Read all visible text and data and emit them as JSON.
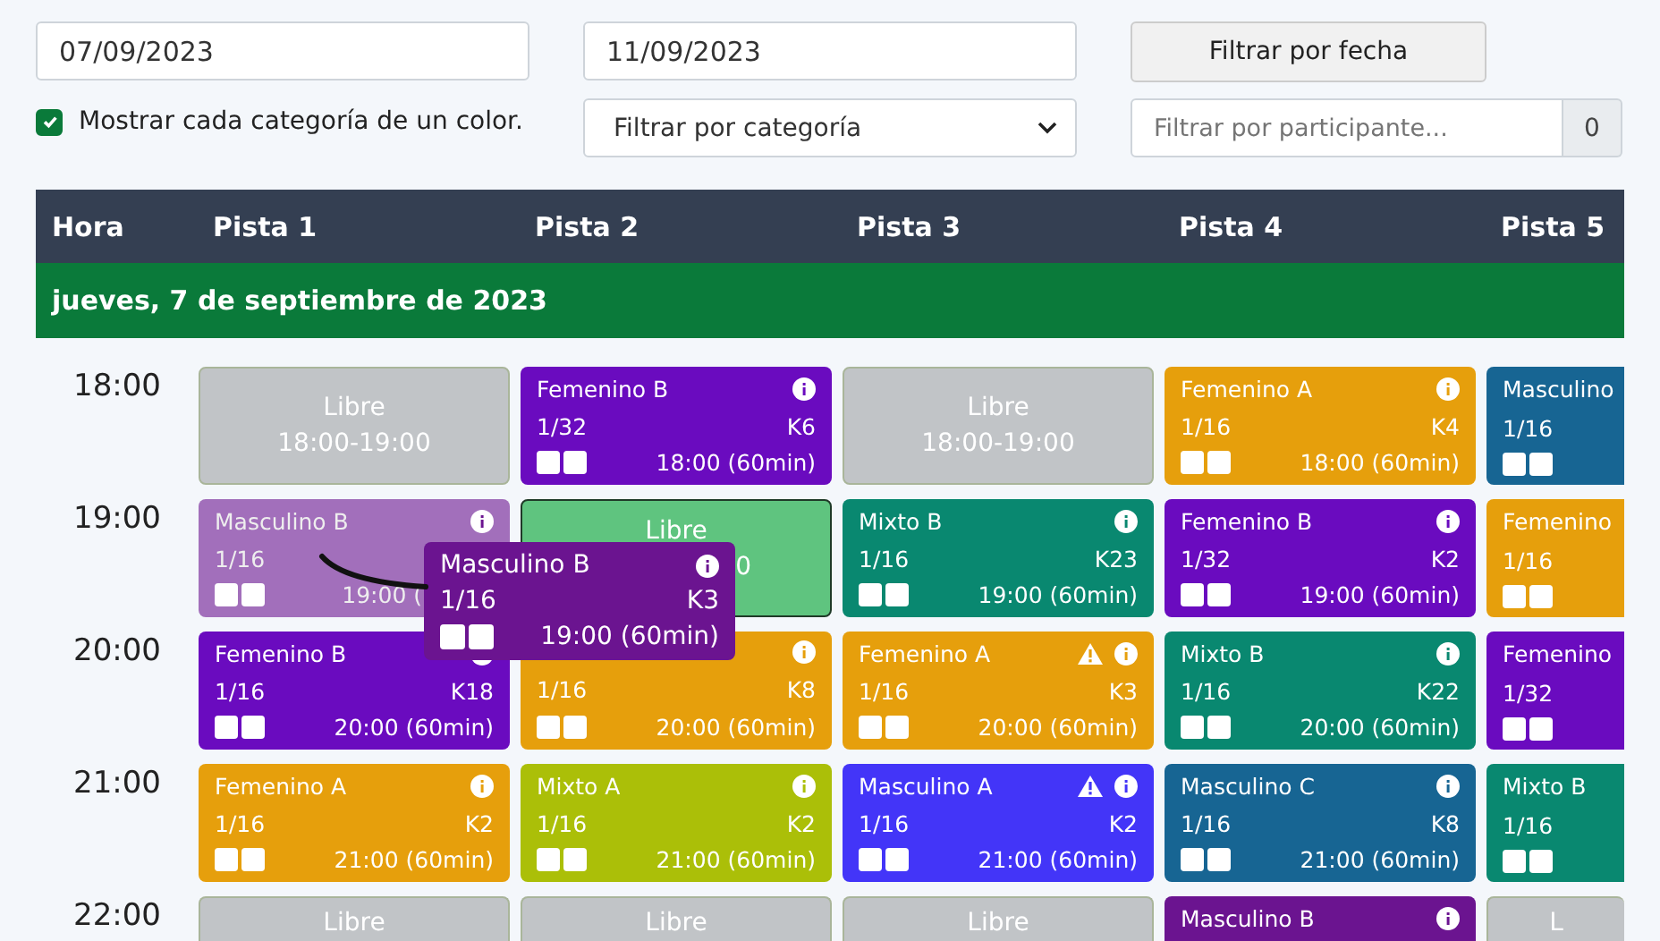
{
  "filters": {
    "date_from": "07/09/2023",
    "date_to": "11/09/2023",
    "date_button": "Filtrar por fecha",
    "color_checkbox": {
      "label": "Mostrar cada categoría de un color.",
      "checked": true
    },
    "category_select": "Filtrar por categoría",
    "participant": {
      "placeholder": "Filtrar por participante...",
      "count": "0"
    }
  },
  "table": {
    "columns": [
      "Hora",
      "Pista 1",
      "Pista 2",
      "Pista 3",
      "Pista 4",
      "Pista 5"
    ],
    "date_row": "jueves, 7 de septiembre de 2023",
    "rows": [
      {
        "hour": "18:00",
        "slots": [
          {
            "kind": "free",
            "label": "Libre",
            "time": "18:00-19:00",
            "color": "#c1c4c7",
            "highlighted": false
          },
          {
            "kind": "match",
            "category": "Femenino B",
            "round": "1/32",
            "code": "K6",
            "time": "18:00 (60min)",
            "color": "#6a0bbf",
            "warning": false,
            "faded": false
          },
          {
            "kind": "free",
            "label": "Libre",
            "time": "18:00-19:00",
            "color": "#c1c4c7",
            "highlighted": false
          },
          {
            "kind": "match",
            "category": "Femenino A",
            "round": "1/16",
            "code": "K4",
            "time": "18:00 (60min)",
            "color": "#e69f0c",
            "warning": false,
            "faded": false
          },
          {
            "kind": "match",
            "category": "Masculino",
            "round": "1/16",
            "color": "#176593",
            "faded": false
          }
        ]
      },
      {
        "hour": "19:00",
        "slots": [
          {
            "kind": "match",
            "category": "Masculino B",
            "round": "1/16",
            "time": "19:00 (",
            "color": "#6b1490",
            "warning": false,
            "faded": true
          },
          {
            "kind": "free",
            "label": "Libre",
            "time": "0",
            "color": "#5fc47f",
            "highlighted": true
          },
          {
            "kind": "match",
            "category": "Mixto B",
            "round": "1/16",
            "code": "K23",
            "time": "19:00 (60min)",
            "color": "#098870",
            "warning": false,
            "faded": false
          },
          {
            "kind": "match",
            "category": "Femenino B",
            "round": "1/32",
            "code": "K2",
            "time": "19:00 (60min)",
            "color": "#6a0bbf",
            "warning": false,
            "faded": false
          },
          {
            "kind": "match",
            "category": "Femenino",
            "round": "1/16",
            "color": "#e69f0c",
            "faded": false
          }
        ]
      },
      {
        "hour": "20:00",
        "slots": [
          {
            "kind": "match",
            "category": "Femenino B",
            "round": "1/16",
            "code": "K18",
            "time": "20:00 (60min)",
            "color": "#6a0bbf",
            "warning": false,
            "faded": false
          },
          {
            "kind": "match",
            "round": "1/16",
            "code": "K8",
            "time": "20:00 (60min)",
            "color": "#e69f0c",
            "warning": false,
            "faded": false
          },
          {
            "kind": "match",
            "category": "Femenino A",
            "round": "1/16",
            "code": "K3",
            "time": "20:00 (60min)",
            "color": "#e69f0c",
            "warning": true,
            "faded": false
          },
          {
            "kind": "match",
            "category": "Mixto B",
            "round": "1/16",
            "code": "K22",
            "time": "20:00 (60min)",
            "color": "#098870",
            "warning": false,
            "faded": false
          },
          {
            "kind": "match",
            "category": "Femenino",
            "round": "1/32",
            "color": "#6a0bbf",
            "faded": false
          }
        ]
      },
      {
        "hour": "21:00",
        "slots": [
          {
            "kind": "match",
            "category": "Femenino A",
            "round": "1/16",
            "code": "K2",
            "time": "21:00 (60min)",
            "color": "#e69f0c",
            "warning": false,
            "faded": false
          },
          {
            "kind": "match",
            "category": "Mixto A",
            "round": "1/16",
            "code": "K2",
            "time": "21:00 (60min)",
            "color": "#abbf08",
            "warning": false,
            "faded": false
          },
          {
            "kind": "match",
            "category": "Masculino A",
            "round": "1/16",
            "code": "K2",
            "time": "21:00 (60min)",
            "color": "#4335f8",
            "warning": true,
            "faded": false
          },
          {
            "kind": "match",
            "category": "Masculino C",
            "round": "1/16",
            "code": "K8",
            "time": "21:00 (60min)",
            "color": "#176593",
            "warning": false,
            "faded": false
          },
          {
            "kind": "match",
            "category": "Mixto B",
            "round": "1/16",
            "color": "#098870",
            "faded": false
          }
        ]
      },
      {
        "hour": "22:00",
        "slots": [
          {
            "kind": "free",
            "label": "Libre",
            "color": "#c1c4c7",
            "highlighted": false
          },
          {
            "kind": "free",
            "label": "Libre",
            "color": "#c1c4c7",
            "highlighted": false
          },
          {
            "kind": "free",
            "label": "Libre",
            "color": "#c1c4c7",
            "highlighted": false
          },
          {
            "kind": "match",
            "category": "Masculino B",
            "color": "#6b1490",
            "warning": false,
            "faded": false
          },
          {
            "kind": "free",
            "label": "L",
            "color": "#c1c4c7",
            "highlighted": false
          }
        ]
      }
    ],
    "dragged_card": {
      "category": "Masculino B",
      "round": "1/16",
      "code": "K3",
      "time": "19:00 (60min)",
      "color": "#6b1490"
    }
  }
}
